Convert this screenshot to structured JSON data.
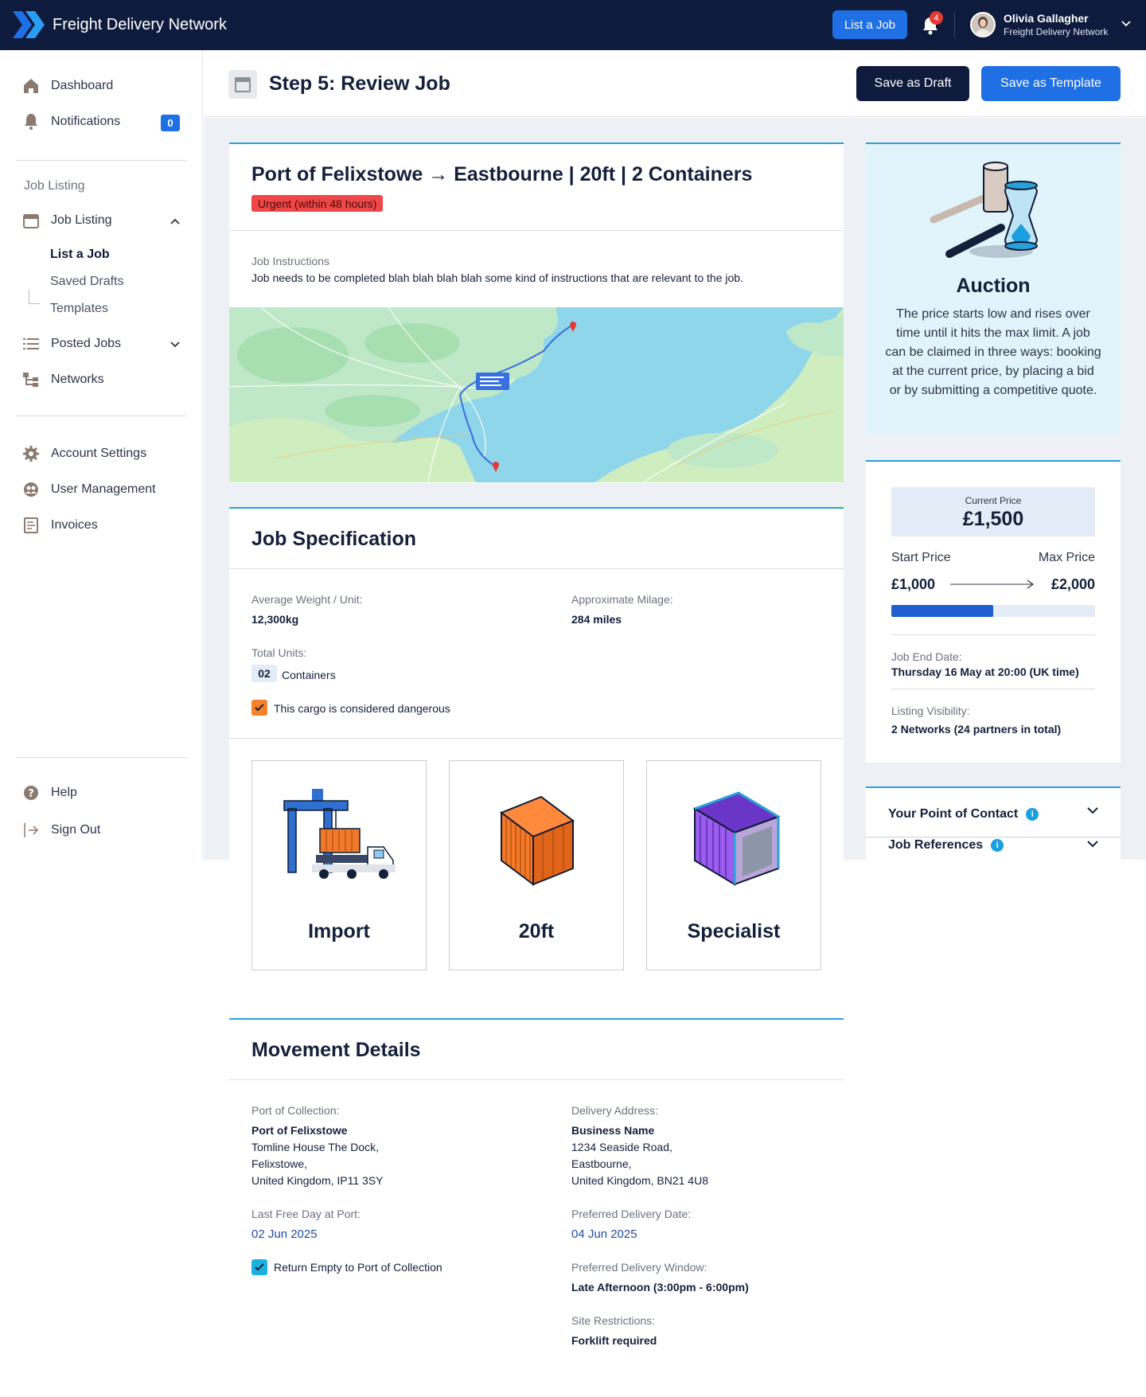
{
  "topbar": {
    "app_title": "Freight Delivery Network",
    "list_job_label": "List a Job",
    "notifications_count": "4",
    "user_name": "Olivia Gallagher",
    "user_org": "Freight Delivery Network"
  },
  "sidebar": {
    "dashboard": "Dashboard",
    "notifications": "Notifications",
    "notifications_badge": "0",
    "section_heading": "Job Listing",
    "job_listing": "Job Listing",
    "sub_items": [
      "List a Job",
      "Saved Drafts",
      "Templates"
    ],
    "posted_jobs": "Posted Jobs",
    "networks": "Networks",
    "account_settings": "Account Settings",
    "user_management": "User Management",
    "invoices": "Invoices",
    "help": "Help",
    "sign_out": "Sign Out"
  },
  "header": {
    "title": "Step 5: Review Job",
    "save_draft": "Save as Draft",
    "save_template": "Save as Template"
  },
  "job": {
    "title": "Port of Felixstowe → Eastbourne | 20ft | 2 Containers",
    "urgency": "Urgent (within 48 hours)",
    "instructions_label": "Job Instructions",
    "instructions": "Job needs to be completed blah blah blah blah some kind of instructions that are relevant to the job."
  },
  "spec": {
    "title": "Job Specification",
    "avg_weight_label": "Average Weight / Unit:",
    "avg_weight": "12,300kg",
    "milage_label": "Approximate Milage:",
    "milage": "284 miles",
    "total_units_label": "Total Units:",
    "units_count": "02",
    "units_name": "Containers",
    "dangerous_label": "This cargo is considered dangerous",
    "dangerous_checked": true,
    "types": [
      "Import",
      "20ft",
      "Specialist"
    ]
  },
  "movement": {
    "title": "Movement Details",
    "collection_label": "Port of Collection:",
    "collection_name": "Port of Felixstowe",
    "collection_lines": [
      "Tomline House The Dock,",
      "Felixstowe,",
      "United Kingdom, IP11 3SY"
    ],
    "last_free_day_label": "Last Free Day at Port:",
    "last_free_day": "02 Jun 2025",
    "return_empty_label": "Return Empty to Port of Collection",
    "return_empty_checked": true,
    "delivery_label": "Delivery Address:",
    "delivery_name": "Business Name",
    "delivery_lines": [
      "1234 Seaside Road,",
      "Eastbourne,",
      "United Kingdom, BN21 4U8"
    ],
    "preferred_date_label": "Preferred Delivery Date:",
    "preferred_date": "04 Jun 2025",
    "window_label": "Preferred Delivery Window:",
    "window": "Late Afternoon (3:00pm - 6:00pm)",
    "site_label": "Site Restrictions:",
    "site": "Forklift required"
  },
  "auction": {
    "title": "Auction",
    "description": "The price starts low and rises over time until it hits the max limit. A job can be claimed in three ways: booking at the current price, by placing a bid or by submitting a competitive quote."
  },
  "pricing": {
    "current_label": "Current Price",
    "current_price": "£1,500",
    "start_label": "Start Price",
    "max_label": "Max Price",
    "start_price": "£1,000",
    "max_price": "£2,000",
    "progress_fraction": 0.5,
    "end_date_label": "Job End Date:",
    "end_date": "Thursday 16 May at 20:00 (UK time)",
    "visibility_label": "Listing Visibility:",
    "visibility": "2 Networks (24 partners in total)"
  },
  "accordions": {
    "contact": "Your Point of Contact",
    "references": "Job References"
  },
  "colors": {
    "navy": "#0f1b3d",
    "primary_blue": "#1f6fe5",
    "accent_cyan": "#2aa0d8",
    "urgent_red": "#ef4747",
    "dangerous_orange": "#f5822a"
  }
}
